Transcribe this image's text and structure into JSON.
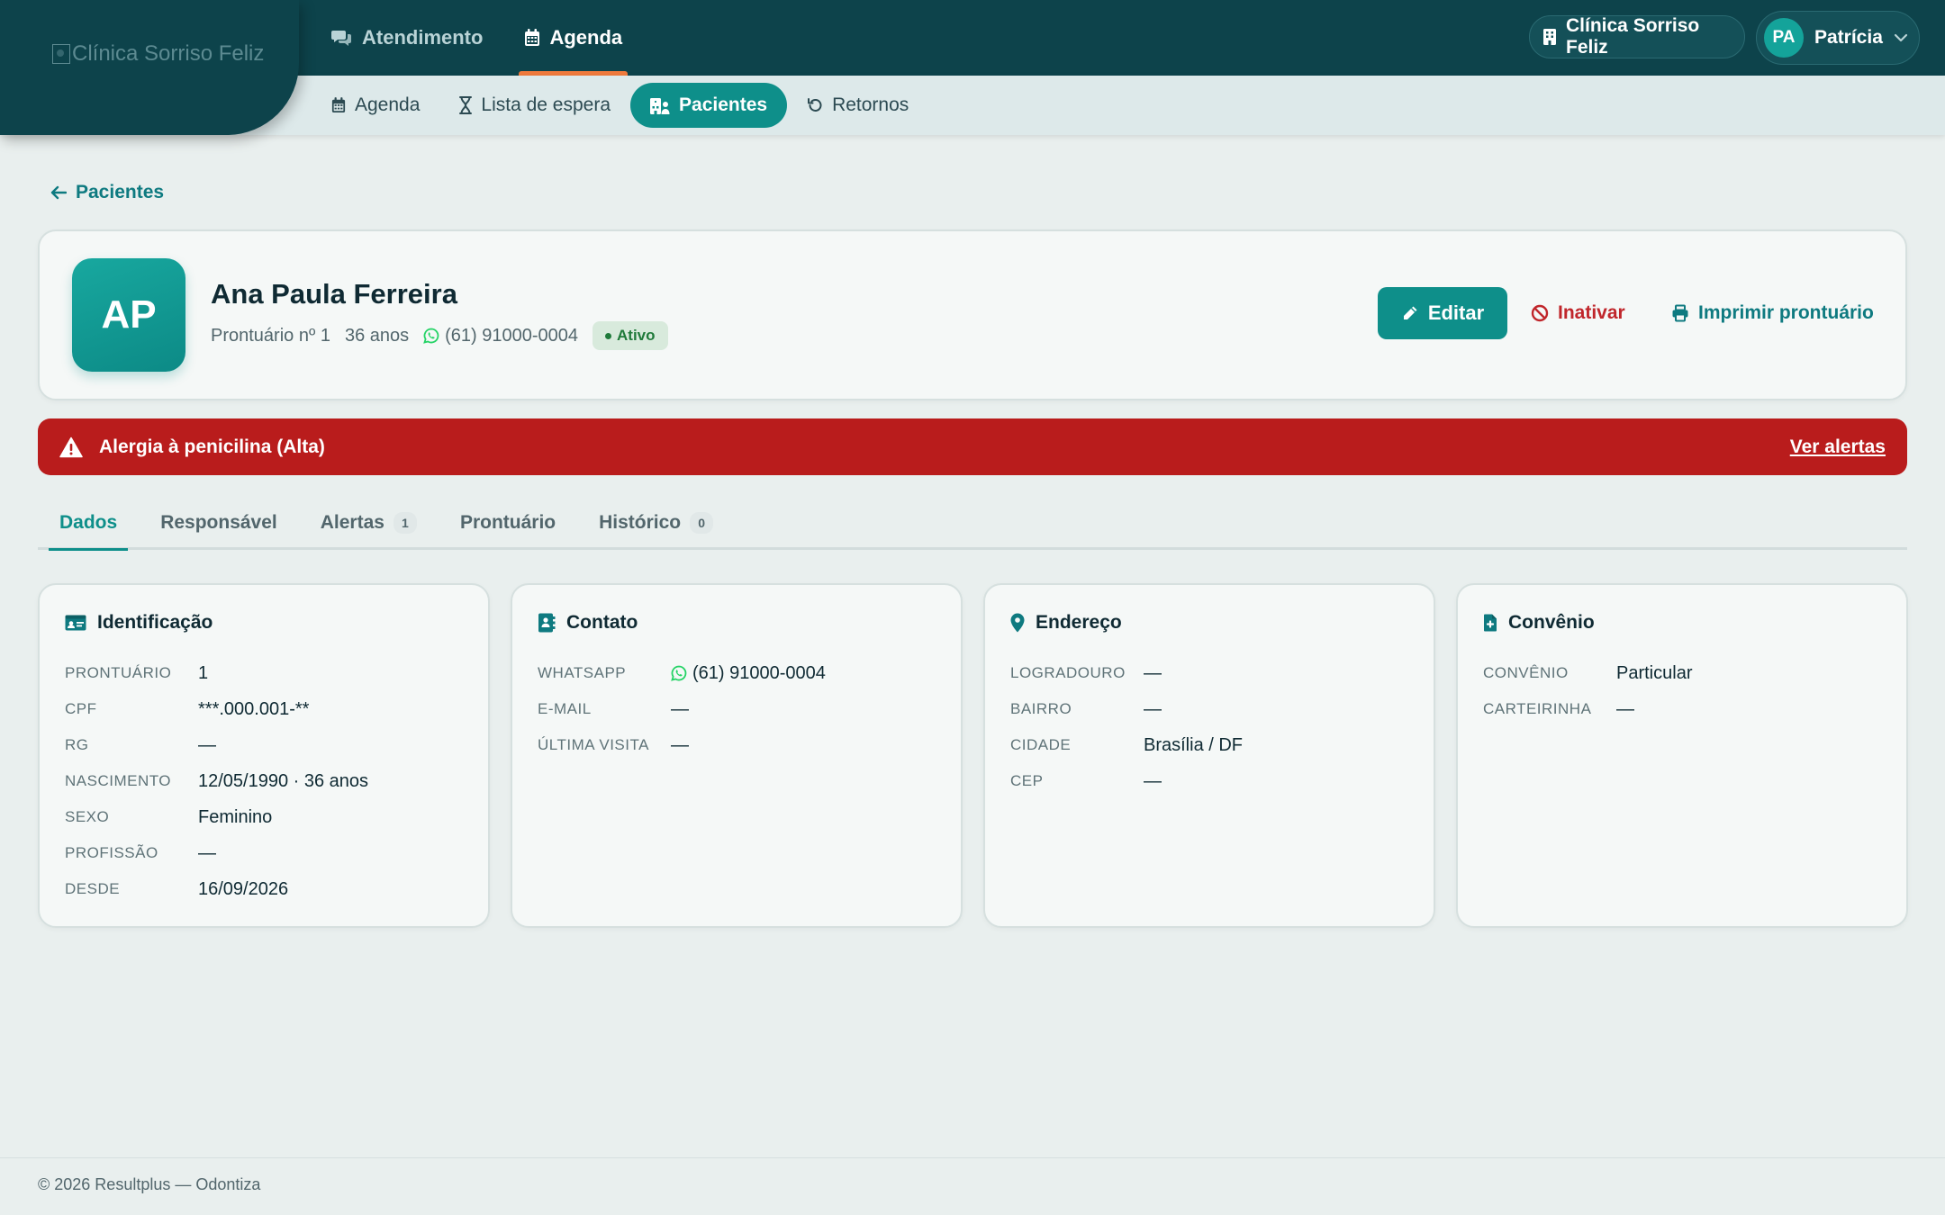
{
  "header": {
    "logo_alt": "Clínica Sorriso Feliz",
    "main_nav": [
      {
        "label": "Atendimento",
        "icon": "comments-icon",
        "active": false
      },
      {
        "label": "Agenda",
        "icon": "calendar-icon",
        "active": true
      }
    ],
    "clinic": "Clínica Sorriso Feliz",
    "user": {
      "initials": "PA",
      "name": "Patrícia"
    }
  },
  "sub_nav": [
    {
      "label": "Agenda",
      "icon": "calendar-icon",
      "active": false
    },
    {
      "label": "Lista de espera",
      "icon": "hourglass-icon",
      "active": false
    },
    {
      "label": "Pacientes",
      "icon": "hospital-user-icon",
      "active": true
    },
    {
      "label": "Retornos",
      "icon": "undo-icon",
      "active": false
    }
  ],
  "back_link": "Pacientes",
  "patient": {
    "initials": "AP",
    "name": "Ana Paula Ferreira",
    "record": "Prontuário nº 1",
    "age": "36 anos",
    "phone": "(61) 91000-0004",
    "status": "Ativo"
  },
  "actions": {
    "edit": "Editar",
    "inactivate": "Inativar",
    "print": "Imprimir prontuário"
  },
  "alert": {
    "text": "Alergia à penicilina (Alta)",
    "link": "Ver alertas"
  },
  "tabs": [
    {
      "label": "Dados",
      "count": null,
      "active": true
    },
    {
      "label": "Responsável",
      "count": null,
      "active": false
    },
    {
      "label": "Alertas",
      "count": "1",
      "active": false
    },
    {
      "label": "Prontuário",
      "count": null,
      "active": false
    },
    {
      "label": "Histórico",
      "count": "0",
      "active": false
    }
  ],
  "cards": {
    "identificacao": {
      "title": "Identificação",
      "rows": [
        {
          "k": "PRONTUÁRIO",
          "v": "1"
        },
        {
          "k": "CPF",
          "v": "***.000.001-**"
        },
        {
          "k": "RG",
          "v": "—"
        },
        {
          "k": "NASCIMENTO",
          "v": "12/05/1990 · 36 anos"
        },
        {
          "k": "SEXO",
          "v": "Feminino"
        },
        {
          "k": "PROFISSÃO",
          "v": "—"
        },
        {
          "k": "DESDE",
          "v": "16/09/2026"
        }
      ]
    },
    "contato": {
      "title": "Contato",
      "rows": [
        {
          "k": "WHATSAPP",
          "v": "(61) 91000-0004"
        },
        {
          "k": "E-MAIL",
          "v": "—"
        },
        {
          "k": "ÚLTIMA VISITA",
          "v": "—"
        }
      ]
    },
    "endereco": {
      "title": "Endereço",
      "rows": [
        {
          "k": "LOGRADOURO",
          "v": "—"
        },
        {
          "k": "BAIRRO",
          "v": "—"
        },
        {
          "k": "CIDADE",
          "v": "Brasília / DF"
        },
        {
          "k": "CEP",
          "v": "—"
        }
      ]
    },
    "convenio": {
      "title": "Convênio",
      "rows": [
        {
          "k": "CONVÊNIO",
          "v": "Particular"
        },
        {
          "k": "CARTEIRINHA",
          "v": "—"
        }
      ]
    }
  },
  "footer": "© 2026 Resultplus — Odontiza",
  "colors": {
    "brand_dark": "#0d434b",
    "accent": "#0e8f8a",
    "active_tab_underline": "#f07a3c",
    "danger": "#b91c1c",
    "whatsapp": "#25d366"
  }
}
